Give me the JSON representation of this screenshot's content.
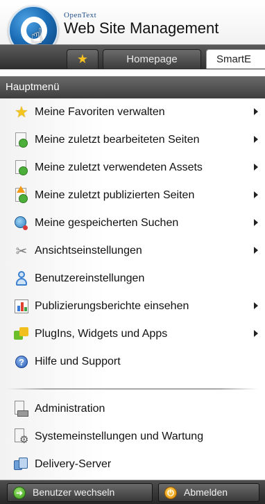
{
  "header": {
    "brand_small": "OpenText",
    "brand_title": "Web Site Management",
    "logo_icon": "opentext-logo-icon",
    "tabs": [
      {
        "icon": "star-icon",
        "label": ""
      },
      {
        "label": "Homepage"
      },
      {
        "label": "SmartE"
      }
    ]
  },
  "menu": {
    "title": "Hauptmenü",
    "items": [
      {
        "icon": "star-icon",
        "label": "Meine Favoriten verwalten",
        "has_submenu": true
      },
      {
        "icon": "page-clock-icon",
        "label": "Meine zuletzt bearbeiteten Seiten",
        "has_submenu": true
      },
      {
        "icon": "page-clock-icon",
        "label": "Meine zuletzt verwendeten Assets",
        "has_submenu": true
      },
      {
        "icon": "page-publish-icon",
        "label": "Meine zuletzt publizierten Seiten",
        "has_submenu": true
      },
      {
        "icon": "saved-search-icon",
        "label": "Meine gespeicherten Suchen",
        "has_submenu": true
      },
      {
        "icon": "tools-icon",
        "label": "Ansichtseinstellungen",
        "has_submenu": true
      },
      {
        "icon": "user-icon",
        "label": "Benutzereinstellungen",
        "has_submenu": false
      },
      {
        "icon": "bar-chart-icon",
        "label": "Publizierungsberichte einsehen",
        "has_submenu": true
      },
      {
        "icon": "puzzle-icon",
        "label": "PlugIns, Widgets und Apps",
        "has_submenu": true
      },
      {
        "icon": "help-icon",
        "label": "Hilfe und Support",
        "has_submenu": false
      }
    ],
    "admin_items": [
      {
        "icon": "administration-icon",
        "label": "Administration"
      },
      {
        "icon": "system-settings-icon",
        "label": "Systemeinstellungen und Wartung"
      },
      {
        "icon": "delivery-server-icon",
        "label": "Delivery-Server"
      }
    ]
  },
  "footer": {
    "switch_user_label": "Benutzer wechseln",
    "logout_label": "Abmelden"
  },
  "colors": {
    "header_bar": "#3e3e3e",
    "tab_star": "#f7c21f",
    "menu_text": "#111111",
    "logo_blue": "#1b6db6"
  }
}
